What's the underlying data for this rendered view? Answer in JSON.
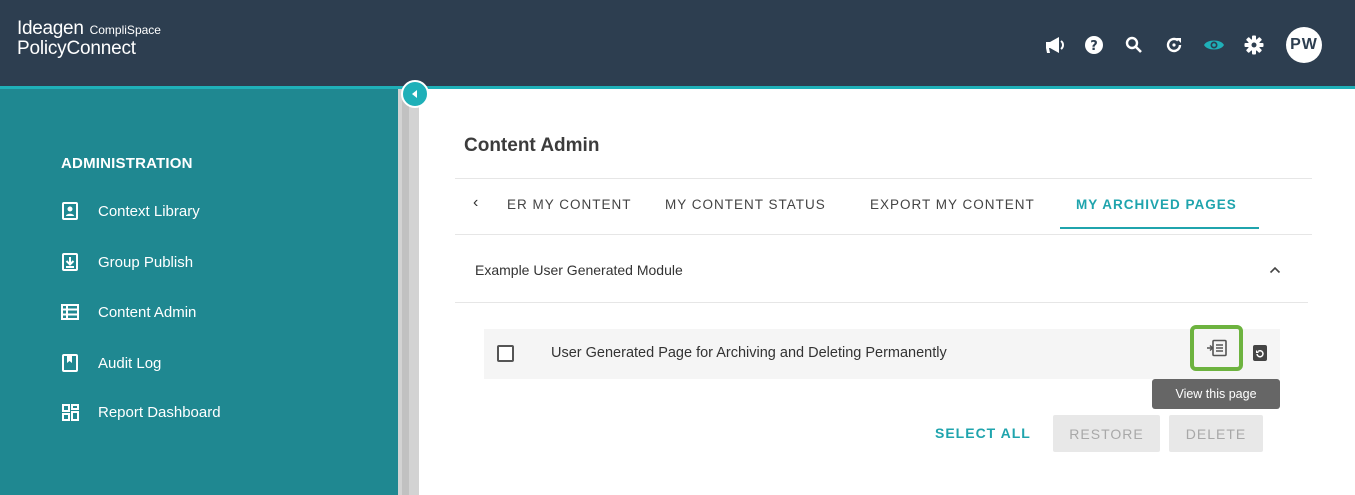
{
  "brand": {
    "name": "Ideagen",
    "sub": "CompliSpace",
    "product": "PolicyConnect"
  },
  "user": {
    "initials": "PW"
  },
  "topbar": {
    "icons": [
      "megaphone-icon",
      "help-icon",
      "search-icon",
      "refresh-icon",
      "eye-icon",
      "gear-icon"
    ]
  },
  "sidebar": {
    "heading": "ADMINISTRATION",
    "items": [
      {
        "label": "Context Library",
        "icon": "contact-card-icon"
      },
      {
        "label": "Group Publish",
        "icon": "download-box-icon"
      },
      {
        "label": "Content Admin",
        "icon": "list-icon"
      },
      {
        "label": "Audit Log",
        "icon": "book-icon"
      },
      {
        "label": "Report Dashboard",
        "icon": "dashboard-icon"
      }
    ]
  },
  "main": {
    "title": "Content Admin",
    "tabs": [
      {
        "label": "ER MY CONTENT"
      },
      {
        "label": "MY CONTENT STATUS"
      },
      {
        "label": "EXPORT MY CONTENT"
      },
      {
        "label": "MY ARCHIVED PAGES",
        "active": true
      }
    ],
    "module": {
      "title": "Example User Generated Module",
      "rows": [
        {
          "label": "User Generated Page for Archiving and Deleting Permanently",
          "checked": false
        }
      ]
    },
    "tooltip": "View this page",
    "actions": {
      "select_all": "SELECT ALL",
      "restore": "RESTORE",
      "delete": "DELETE"
    }
  },
  "colors": {
    "topbar": "#2d3e50",
    "sidebar": "#1f8891",
    "accent": "#1fa4ad",
    "highlight": "#6db33f"
  }
}
